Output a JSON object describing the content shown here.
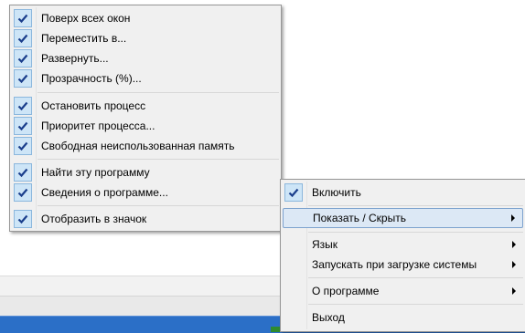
{
  "main_menu": {
    "items": [
      {
        "label": "Поверх всех окон",
        "checked": true
      },
      {
        "label": "Переместить в...",
        "checked": true
      },
      {
        "label": "Развернуть...",
        "checked": true
      },
      {
        "label": "Прозрачность (%)...",
        "checked": true
      },
      {
        "label": "Остановить процесс",
        "checked": true
      },
      {
        "label": "Приоритет процесса...",
        "checked": true
      },
      {
        "label": "Свободная неиспользованная память",
        "checked": true
      },
      {
        "label": "Найти эту программу",
        "checked": true
      },
      {
        "label": "Сведения о  программе...",
        "checked": true
      },
      {
        "label": "Отобразить в значок",
        "checked": true
      }
    ]
  },
  "tray_menu": {
    "items": [
      {
        "label": "Включить",
        "checked": true
      },
      {
        "label": "Показать / Скрыть",
        "submenu": true,
        "highlighted": true
      },
      {
        "label": "Язык",
        "submenu": true
      },
      {
        "label": "Запускать при загрузке системы",
        "submenu": true
      },
      {
        "label": "О программе",
        "submenu": true
      },
      {
        "label": "Выход"
      }
    ]
  },
  "colors": {
    "menu_bg": "#f0f0f0",
    "check_bg": "#cde5f7",
    "check_mark": "#1a3e8c",
    "highlight_bg": "#dce8f5",
    "taskbar": "#2b6fc7"
  }
}
